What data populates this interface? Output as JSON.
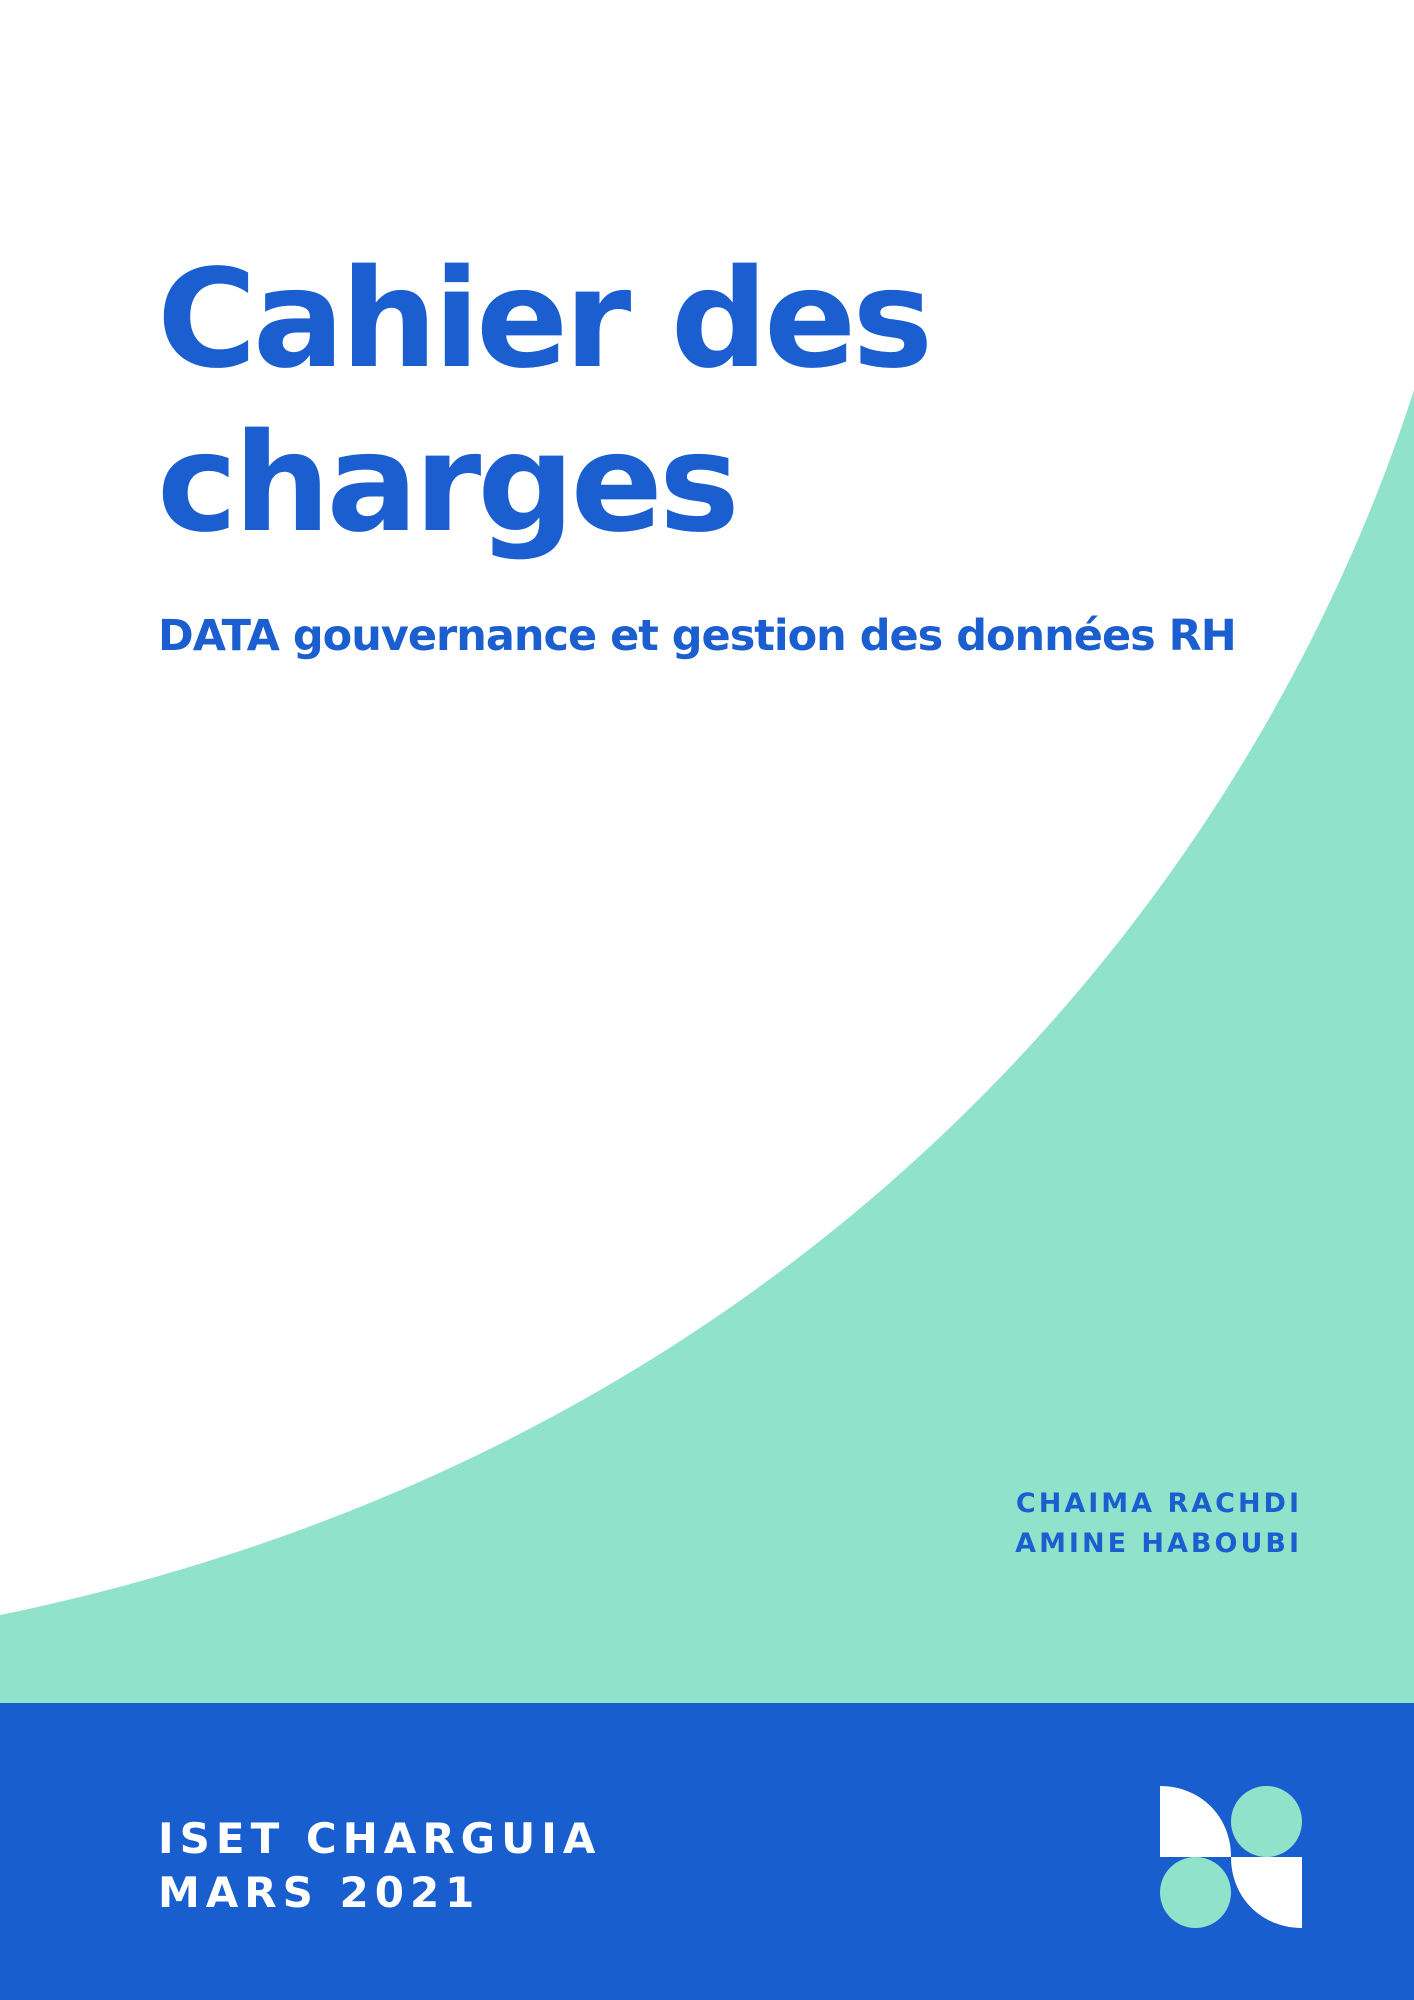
{
  "cover": {
    "title_line1": "Cahier des",
    "title_line2": "charges",
    "subtitle": "DATA gouvernance et gestion des données RH",
    "authors": [
      "CHAIMA RACHDI",
      "AMINE HABOUBI"
    ],
    "institution": "ISET CHARGUIA",
    "date": "MARS 2021"
  },
  "colors": {
    "primary_blue": "#185ecf",
    "mint": "#90e3ca",
    "background": "#ffffff",
    "footer_text": "#ffffff"
  },
  "icons": {
    "logo": "geometric-logo-icon"
  }
}
